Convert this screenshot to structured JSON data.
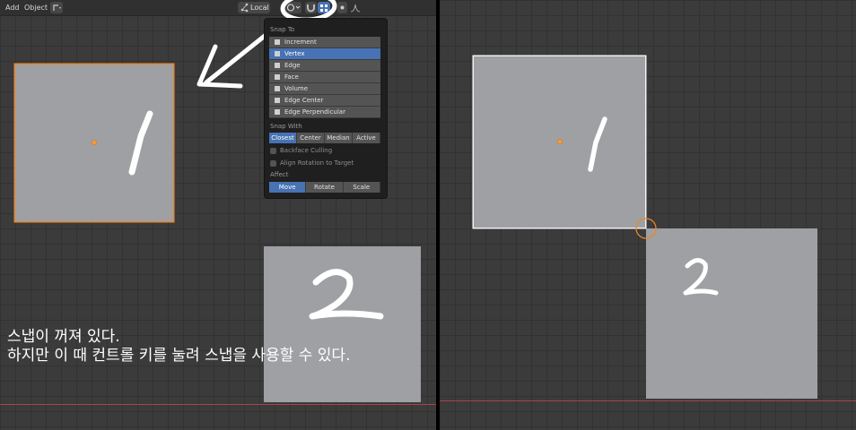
{
  "header": {
    "menu_add": "Add",
    "menu_object": "Object",
    "orientation": "Local"
  },
  "snap_popup": {
    "snap_to_label": "Snap To",
    "snap_to_items": [
      "Increment",
      "Vertex",
      "Edge",
      "Face",
      "Volume",
      "Edge Center",
      "Edge Perpendicular"
    ],
    "selected_snap_to": "Vertex",
    "snap_with_label": "Snap With",
    "snap_with_options": [
      "Closest",
      "Center",
      "Median",
      "Active"
    ],
    "selected_snap_with": "Closest",
    "backface_culling": "Backface Culling",
    "align_rotation": "Align Rotation to Target",
    "affect_label": "Affect",
    "affect_options": [
      "Move",
      "Rotate",
      "Scale"
    ],
    "selected_affect": "Move"
  },
  "caption": {
    "line1": "스냅이 꺼져 있다.",
    "line2": "하지만 이 때 컨트롤 키를 눌려 스냅을 사용할 수 있다."
  },
  "objects": {
    "square1_label": "1",
    "square2_label": "2"
  },
  "colors": {
    "viewport_bg": "#3b3b3b",
    "grid": "#323232",
    "object_gray": "#9ea0a3",
    "selection_orange": "#e8872c",
    "active_blue": "#4772b3",
    "x_axis_red": "#a8424c"
  },
  "icons": [
    "transform-pivot-icon",
    "proportional-edit-icon",
    "snap-magnet-icon",
    "snap-vertex-icon",
    "falloff-curve-icon"
  ]
}
